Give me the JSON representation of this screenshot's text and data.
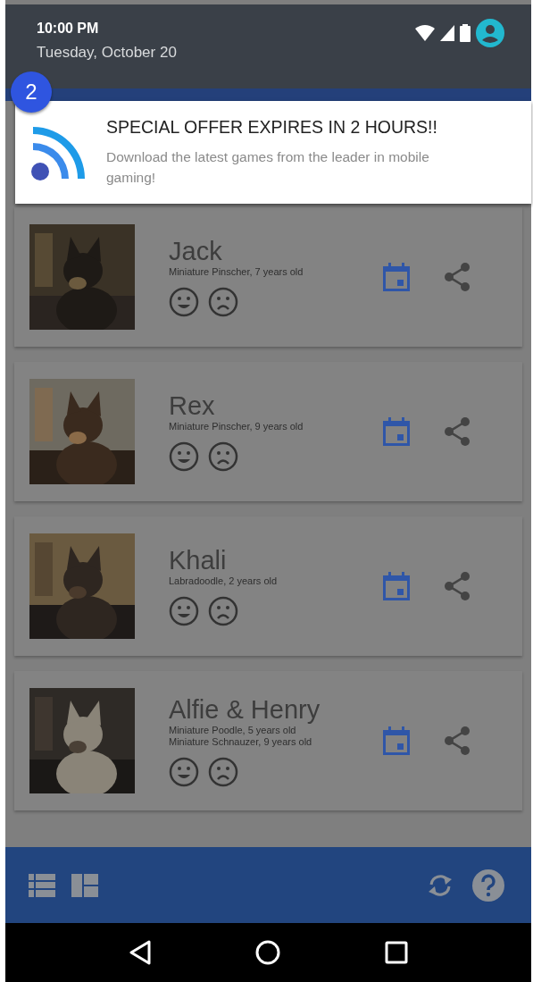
{
  "status": {
    "time": "10:00 PM",
    "date": "Tuesday, October 20"
  },
  "notification": {
    "badge": "2",
    "title": "SPECIAL OFFER EXPIRES IN 2 HOURS!!",
    "body": "Download the latest games from the leader in mobile gaming!"
  },
  "dogs": [
    {
      "name": "Jack",
      "details": [
        "Miniature Pinscher, 7 years old"
      ]
    },
    {
      "name": "Rex",
      "details": [
        "Miniature Pinscher, 9 years old"
      ]
    },
    {
      "name": "Khali",
      "details": [
        "Labradoodle, 2 years old"
      ]
    },
    {
      "name": "Alfie & Henry",
      "details": [
        "Miniature Poodle, 5 years old",
        "Miniature Schnauzer, 9 years old"
      ]
    }
  ]
}
